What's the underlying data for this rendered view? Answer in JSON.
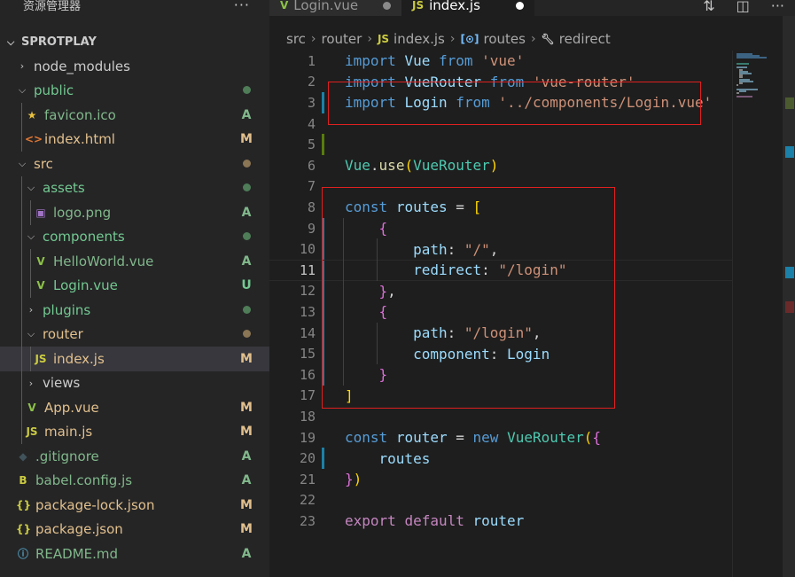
{
  "explorer": {
    "title": "资源管理器",
    "more_label": "···",
    "project": "SPROTPLAY",
    "items": [
      {
        "label": "node_modules",
        "kind": "folder",
        "open": false,
        "depth": 1,
        "status": "",
        "dot": "",
        "color": "#cccccc",
        "icon": ""
      },
      {
        "label": "public",
        "kind": "folder",
        "open": true,
        "depth": 1,
        "status": "",
        "dot": "#4e7d58",
        "color": "#73c991",
        "icon": ""
      },
      {
        "label": "favicon.ico",
        "kind": "file",
        "depth": 2,
        "status": "A",
        "dot": "",
        "color": "#81b88b",
        "icon": "★",
        "icon_color": "#e8c03f"
      },
      {
        "label": "index.html",
        "kind": "file",
        "depth": 2,
        "status": "M",
        "dot": "",
        "color": "#e2c08d",
        "icon": "<>",
        "icon_color": "#e37933"
      },
      {
        "label": "src",
        "kind": "folder",
        "open": true,
        "depth": 1,
        "status": "",
        "dot": "#8a7554",
        "color": "#e2c08d",
        "icon": ""
      },
      {
        "label": "assets",
        "kind": "folder",
        "open": true,
        "depth": 2,
        "status": "",
        "dot": "#4e7d58",
        "color": "#73c991",
        "icon": ""
      },
      {
        "label": "logo.png",
        "kind": "file",
        "depth": 3,
        "status": "A",
        "dot": "",
        "color": "#81b88b",
        "icon": "▣",
        "icon_color": "#a074c4"
      },
      {
        "label": "components",
        "kind": "folder",
        "open": true,
        "depth": 2,
        "status": "",
        "dot": "#4e7d58",
        "color": "#73c991",
        "icon": ""
      },
      {
        "label": "HelloWorld.vue",
        "kind": "file",
        "depth": 3,
        "status": "A",
        "dot": "",
        "color": "#81b88b",
        "icon": "V",
        "icon_color": "#8dc149"
      },
      {
        "label": "Login.vue",
        "kind": "file",
        "depth": 3,
        "status": "U",
        "dot": "",
        "color": "#73c991",
        "icon": "V",
        "icon_color": "#8dc149"
      },
      {
        "label": "plugins",
        "kind": "folder",
        "open": false,
        "depth": 2,
        "status": "",
        "dot": "#4e7d58",
        "color": "#73c991",
        "icon": ""
      },
      {
        "label": "router",
        "kind": "folder",
        "open": true,
        "depth": 2,
        "status": "",
        "dot": "#8a7554",
        "color": "#e2c08d",
        "icon": ""
      },
      {
        "label": "index.js",
        "kind": "file",
        "depth": 3,
        "status": "M",
        "dot": "",
        "color": "#e2c08d",
        "icon": "JS",
        "icon_color": "#cbcb41",
        "selected": true
      },
      {
        "label": "views",
        "kind": "folder",
        "open": false,
        "depth": 2,
        "status": "",
        "dot": "",
        "color": "#cccccc",
        "icon": ""
      },
      {
        "label": "App.vue",
        "kind": "file",
        "depth": 2,
        "status": "M",
        "dot": "",
        "color": "#e2c08d",
        "icon": "V",
        "icon_color": "#8dc149"
      },
      {
        "label": "main.js",
        "kind": "file",
        "depth": 2,
        "status": "M",
        "dot": "",
        "color": "#e2c08d",
        "icon": "JS",
        "icon_color": "#cbcb41"
      },
      {
        "label": ".gitignore",
        "kind": "file",
        "depth": 1,
        "status": "A",
        "dot": "",
        "color": "#81b88b",
        "icon": "◆",
        "icon_color": "#41535b"
      },
      {
        "label": "babel.config.js",
        "kind": "file",
        "depth": 1,
        "status": "A",
        "dot": "",
        "color": "#81b88b",
        "icon": "B",
        "icon_color": "#cbcb41"
      },
      {
        "label": "package-lock.json",
        "kind": "file",
        "depth": 1,
        "status": "M",
        "dot": "",
        "color": "#e2c08d",
        "icon": "{}",
        "icon_color": "#cbcb41"
      },
      {
        "label": "package.json",
        "kind": "file",
        "depth": 1,
        "status": "M",
        "dot": "",
        "color": "#e2c08d",
        "icon": "{}",
        "icon_color": "#cbcb41"
      },
      {
        "label": "README.md",
        "kind": "file",
        "depth": 1,
        "status": "A",
        "dot": "",
        "color": "#81b88b",
        "icon": "ⓘ",
        "icon_color": "#519aba"
      }
    ]
  },
  "tabs": [
    {
      "label": "Login.vue",
      "icon": "V",
      "icon_color": "#8dc149",
      "active": false
    },
    {
      "label": "index.js",
      "icon": "JS",
      "icon_color": "#cbcb41",
      "active": true
    }
  ],
  "editor_actions": {
    "compare": "⇅",
    "split": "◫",
    "more": "···"
  },
  "breadcrumb": {
    "parts": [
      "src",
      "router",
      "index.js",
      "routes",
      "redirect"
    ],
    "icons": [
      "",
      "",
      "JS",
      "[⊙]",
      "🔧"
    ]
  },
  "editor": {
    "current_line": 11,
    "lines": [
      {
        "n": "1",
        "tokens": [
          [
            "k",
            "import"
          ],
          [
            "p",
            " "
          ],
          [
            "v",
            "Vue"
          ],
          [
            "p",
            " "
          ],
          [
            "k",
            "from"
          ],
          [
            "p",
            " "
          ],
          [
            "s",
            "'vue'"
          ]
        ]
      },
      {
        "n": "2",
        "tokens": [
          [
            "k",
            "import"
          ],
          [
            "p",
            " "
          ],
          [
            "v",
            "VueRouter"
          ],
          [
            "p",
            " "
          ],
          [
            "k",
            "from"
          ],
          [
            "p",
            " "
          ],
          [
            "s",
            "'vue-router'"
          ]
        ]
      },
      {
        "n": "3",
        "tokens": [
          [
            "k",
            "import"
          ],
          [
            "p",
            " "
          ],
          [
            "v",
            "Login"
          ],
          [
            "p",
            " "
          ],
          [
            "k",
            "from"
          ],
          [
            "p",
            " "
          ],
          [
            "s",
            "'../components/Login.vue'"
          ]
        ]
      },
      {
        "n": "4",
        "tokens": []
      },
      {
        "n": "5",
        "tokens": []
      },
      {
        "n": "6",
        "tokens": [
          [
            "t",
            "Vue"
          ],
          [
            "p",
            "."
          ],
          [
            "f",
            "use"
          ],
          [
            "br",
            "("
          ],
          [
            "t",
            "VueRouter"
          ],
          [
            "br",
            ")"
          ]
        ]
      },
      {
        "n": "7",
        "tokens": []
      },
      {
        "n": "8",
        "tokens": [
          [
            "k",
            "const"
          ],
          [
            "p",
            " "
          ],
          [
            "v",
            "routes"
          ],
          [
            "p",
            " = "
          ],
          [
            "br",
            "["
          ]
        ]
      },
      {
        "n": "9",
        "tokens": [
          [
            "p",
            "    "
          ],
          [
            "br2",
            "{"
          ]
        ]
      },
      {
        "n": "10",
        "tokens": [
          [
            "p",
            "        "
          ],
          [
            "v",
            "path"
          ],
          [
            "p",
            ": "
          ],
          [
            "s",
            "\"/\""
          ],
          [
            "p",
            ","
          ]
        ]
      },
      {
        "n": "11",
        "tokens": [
          [
            "p",
            "        "
          ],
          [
            "v",
            "redirect"
          ],
          [
            "p",
            ": "
          ],
          [
            "s",
            "\"/login\""
          ]
        ]
      },
      {
        "n": "12",
        "tokens": [
          [
            "p",
            "    "
          ],
          [
            "br2",
            "}"
          ],
          [
            "p",
            ","
          ]
        ]
      },
      {
        "n": "13",
        "tokens": [
          [
            "p",
            "    "
          ],
          [
            "br2",
            "{"
          ]
        ]
      },
      {
        "n": "14",
        "tokens": [
          [
            "p",
            "        "
          ],
          [
            "v",
            "path"
          ],
          [
            "p",
            ": "
          ],
          [
            "s",
            "\"/login\""
          ],
          [
            "p",
            ","
          ]
        ]
      },
      {
        "n": "15",
        "tokens": [
          [
            "p",
            "        "
          ],
          [
            "v",
            "component"
          ],
          [
            "p",
            ": "
          ],
          [
            "v",
            "Login"
          ]
        ]
      },
      {
        "n": "16",
        "tokens": [
          [
            "p",
            "    "
          ],
          [
            "br2",
            "}"
          ]
        ]
      },
      {
        "n": "17",
        "tokens": [
          [
            "br",
            "]"
          ]
        ]
      },
      {
        "n": "18",
        "tokens": []
      },
      {
        "n": "19",
        "tokens": [
          [
            "k",
            "const"
          ],
          [
            "p",
            " "
          ],
          [
            "v",
            "router"
          ],
          [
            "p",
            " = "
          ],
          [
            "k",
            "new"
          ],
          [
            "p",
            " "
          ],
          [
            "t",
            "VueRouter"
          ],
          [
            "br",
            "("
          ],
          [
            "br2",
            "{"
          ]
        ]
      },
      {
        "n": "20",
        "tokens": [
          [
            "p",
            "    "
          ],
          [
            "v",
            "routes"
          ]
        ]
      },
      {
        "n": "21",
        "tokens": [
          [
            "br2",
            "}"
          ],
          [
            "br",
            ")"
          ]
        ]
      },
      {
        "n": "22",
        "tokens": []
      },
      {
        "n": "23",
        "tokens": [
          [
            "kc",
            "export"
          ],
          [
            "p",
            " "
          ],
          [
            "kc",
            "default"
          ],
          [
            "p",
            " "
          ],
          [
            "v",
            "router"
          ]
        ]
      }
    ]
  },
  "colors": {
    "highlight_box": "#e02020",
    "git_added": "#587c0c",
    "git_modified": "#1b81a8"
  }
}
